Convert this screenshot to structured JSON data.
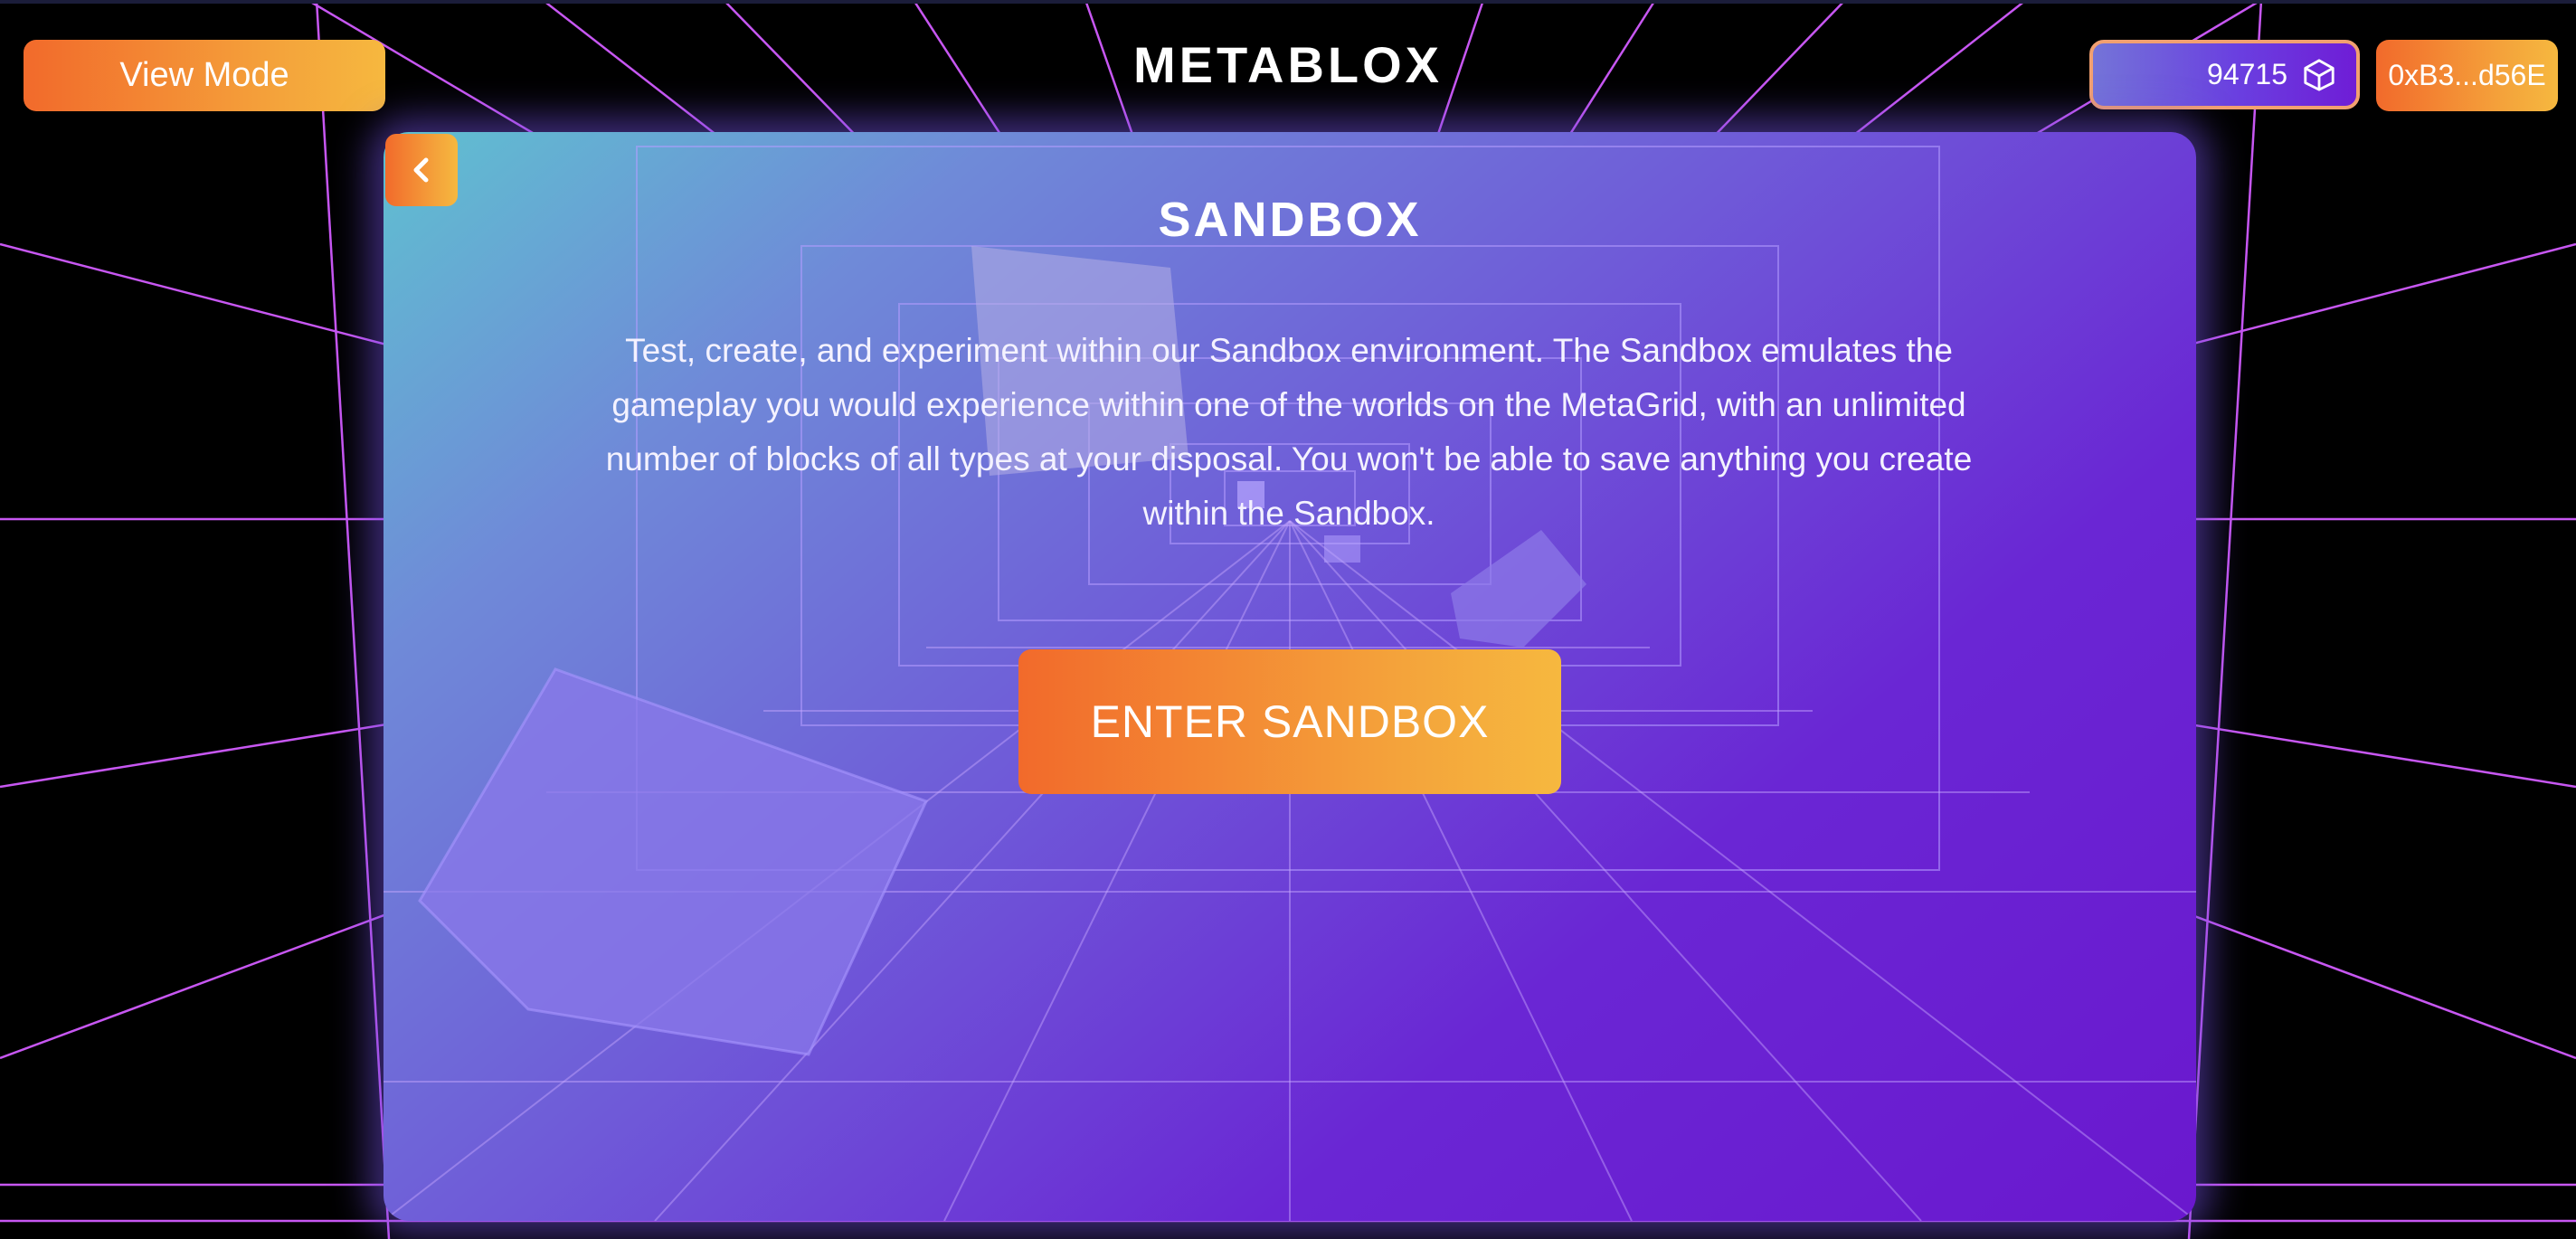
{
  "header": {
    "view_mode_label": "View Mode",
    "brand": "METABLOX",
    "balance": "94715",
    "balance_icon": "cube-token-icon",
    "wallet_label": "0xB3...d56E"
  },
  "panel": {
    "back_icon": "chevron-left-icon",
    "title": "SANDBOX",
    "description": "Test, create, and experiment within our Sandbox environment. The Sandbox emulates the gameplay you would experience within one of the worlds on the MetaGrid, with an unlimited number of blocks of all types at your disposal. You won't be able to save anything you create within the Sandbox.",
    "enter_label": "ENTER SANDBOX"
  },
  "colors": {
    "accent_orange": "#f26a2b",
    "accent_yellow": "#f6b83f",
    "grid_line": "#d25cff",
    "panel_purple": "#6a18ce",
    "panel_teal": "#5fc1d0"
  }
}
